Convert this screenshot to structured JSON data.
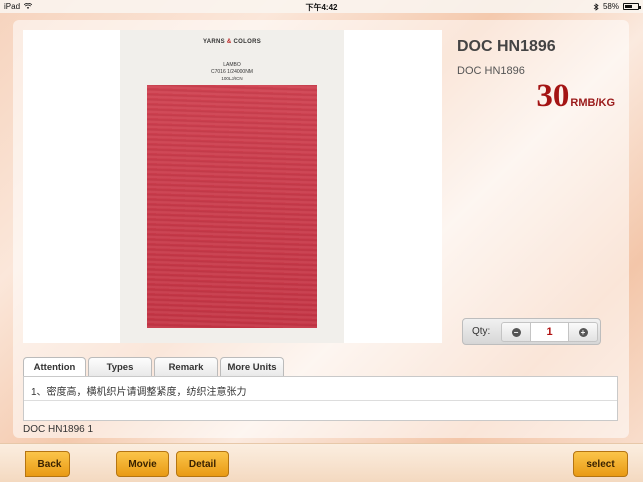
{
  "status_bar": {
    "device": "iPad",
    "time": "下午4:42",
    "battery": "58%",
    "battery_level": 0.58,
    "icons": [
      "wifi-icon",
      "bluetooth-icon",
      "battery-icon"
    ]
  },
  "product": {
    "title": "DOC HN1896",
    "subtitle": "DOC HN1896",
    "price_value": "30",
    "price_unit": "RMB/KG",
    "image": {
      "brand": "YARNS",
      "brand_amp": "&",
      "brand_end": "COLORS",
      "line1": "LAMBO",
      "line2": "C7016    1/24000NM",
      "line3": "100LJ/ICN",
      "swatch_color": "#c93a4a"
    }
  },
  "quantity": {
    "label": "Qty:",
    "value": "1",
    "minus_symbol": "−",
    "plus_symbol": "+"
  },
  "tabs": [
    {
      "label": "Attention",
      "active": true
    },
    {
      "label": "Types",
      "active": false
    },
    {
      "label": "Remark",
      "active": false
    },
    {
      "label": "More Units",
      "active": false
    }
  ],
  "tab_content": "1、密度高，横机织片请调整紧度，纺织注意张力",
  "footer_note": "DOC HN1896 1",
  "toolbar": {
    "back_label": "Back",
    "movie_label": "Movie",
    "detail_label": "Detail",
    "select_label": "select"
  },
  "colors": {
    "accent": "#e99a14",
    "price": "#a41414"
  }
}
